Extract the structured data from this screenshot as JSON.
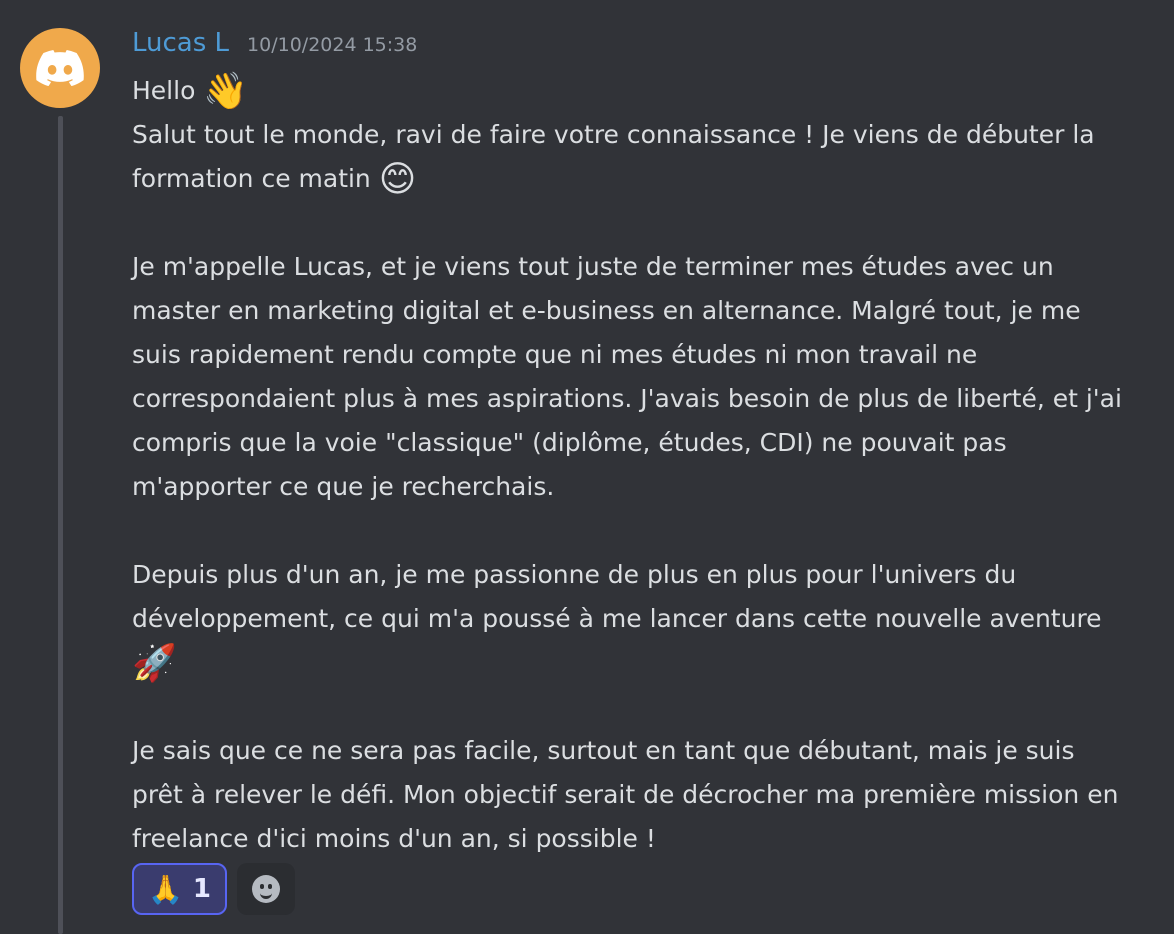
{
  "message": {
    "author": "Lucas L",
    "timestamp": "10/10/2024 15:38",
    "line_hello": "Hello",
    "emoji_wave": "👋",
    "line_salut": "Salut tout le monde, ravi de faire votre connaissance ! Je viens de débuter la formation ce matin",
    "emoji_smile": "😊",
    "para_intro": "Je m'appelle Lucas, et je viens tout juste de terminer mes études avec un master en marketing digital et e-business en alternance. Malgré tout, je me suis rapidement rendu compte que ni mes études ni mon travail ne correspondaient plus à mes aspirations. J'avais besoin de plus de liberté, et j'ai compris que la voie \"classique\" (diplôme, études, CDI) ne pouvait pas m'apporter ce que je recherchais.",
    "para_dev": "Depuis plus d'un an, je me passionne de plus en plus pour l'univers du développement, ce qui m'a poussé à me lancer dans cette nouvelle aventure",
    "emoji_rocket": "🚀",
    "para_goal": "Je sais que ce ne sera pas facile, surtout en tant que débutant, mais je suis prêt à relever le défi. Mon objectif serait de décrocher ma première mission en freelance d'ici moins d'un an, si possible !"
  },
  "reactions": [
    {
      "emoji": "🙏",
      "count": "1"
    }
  ],
  "icons": {
    "avatar": "discord-logo-icon",
    "add_reaction": "smiley-add-reaction-icon"
  },
  "colors": {
    "background": "#313338",
    "username": "#4e9bd6",
    "avatar_bg": "#f0a94b",
    "reaction_border": "#5865f2"
  }
}
